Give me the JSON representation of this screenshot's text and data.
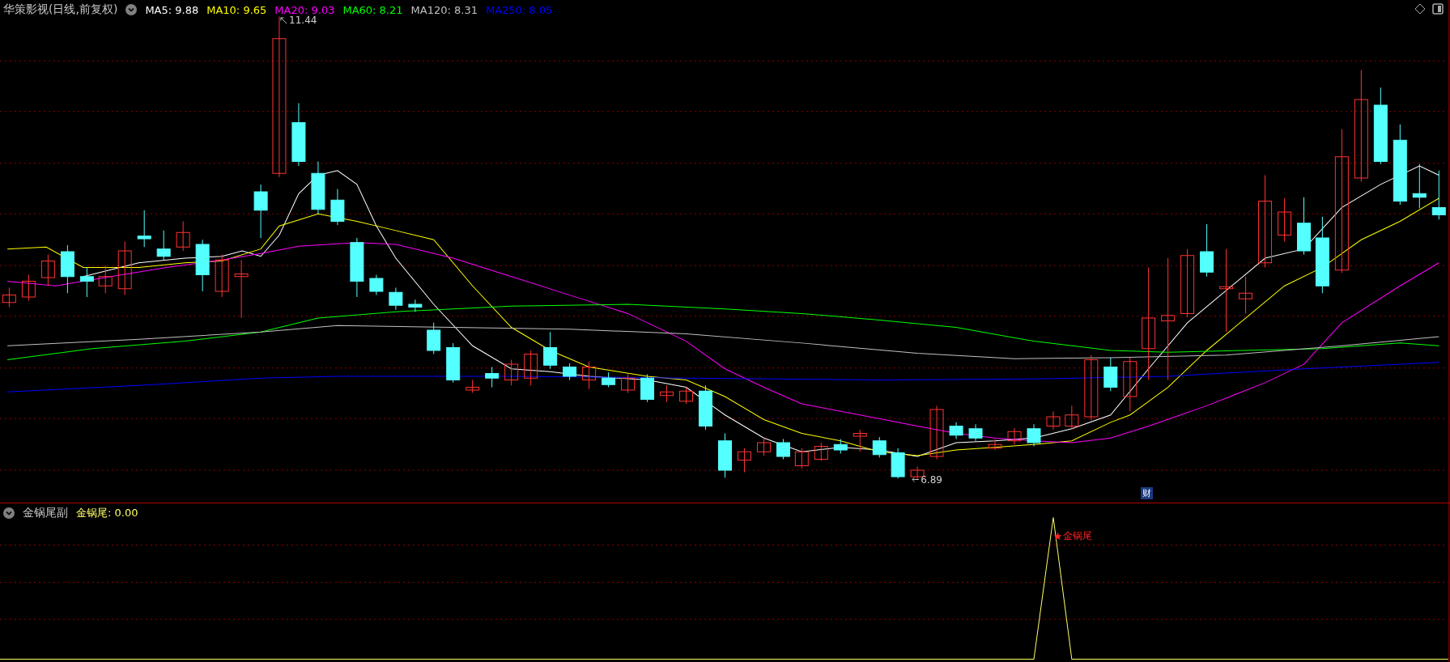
{
  "title": "华策影视(日线,前复权)",
  "ma_legend": [
    {
      "label": "MA5: 9.88",
      "color": "#ffffff"
    },
    {
      "label": "MA10: 9.65",
      "color": "#ffff00"
    },
    {
      "label": "MA20: 9.03",
      "color": "#ff00ff"
    },
    {
      "label": "MA60: 8.21",
      "color": "#00ff00"
    },
    {
      "label": "MA120: 8.31",
      "color": "#c0c0c0"
    },
    {
      "label": "MA250: 8.05",
      "color": "#0000ff"
    }
  ],
  "main_chart": {
    "high_label": "11.44",
    "low_label": "6.89",
    "marker": "财"
  },
  "sub_panel": {
    "title": "金锅尾副",
    "indicator": "金锅尾: 0.00",
    "signal_label": "金锅尾"
  }
}
